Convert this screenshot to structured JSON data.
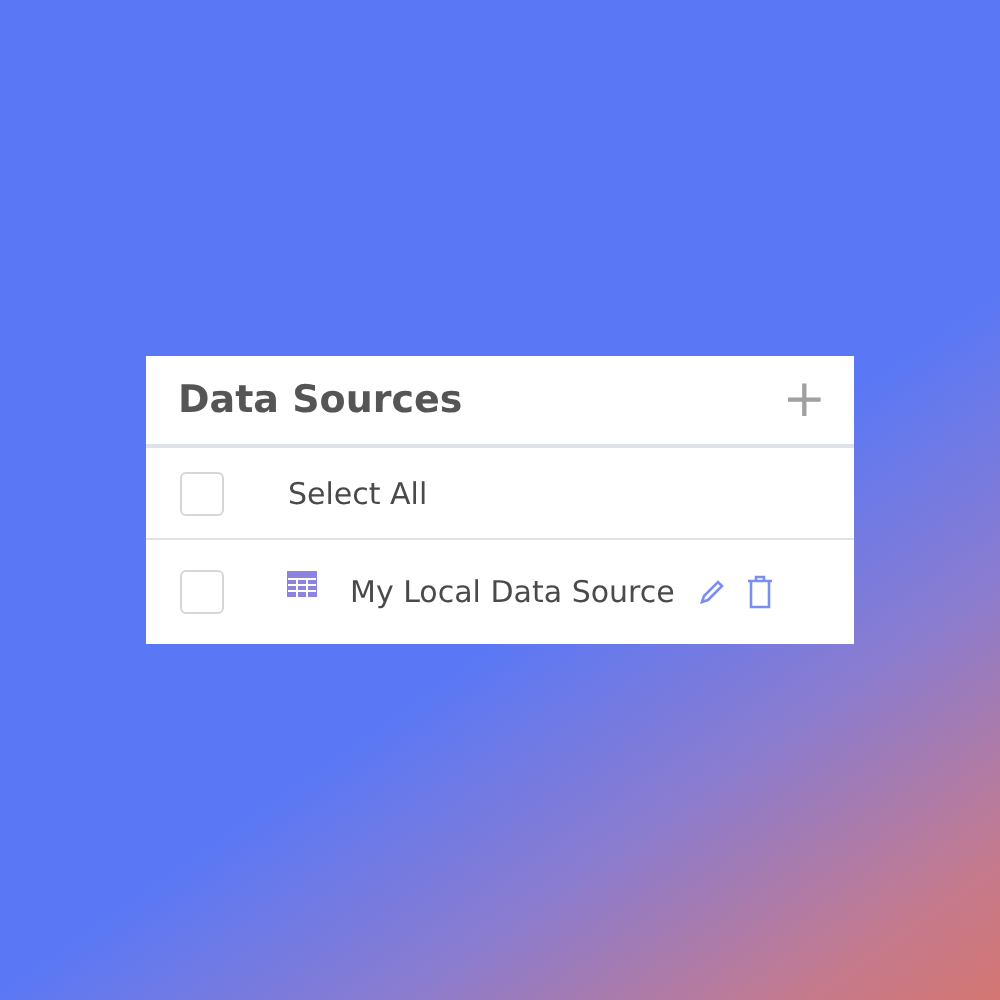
{
  "panel": {
    "title": "Data Sources",
    "add_label": "+"
  },
  "select_all": {
    "label": "Select All",
    "checked": false
  },
  "sources": [
    {
      "name": "My Local Data Source",
      "checked": false
    }
  ]
}
